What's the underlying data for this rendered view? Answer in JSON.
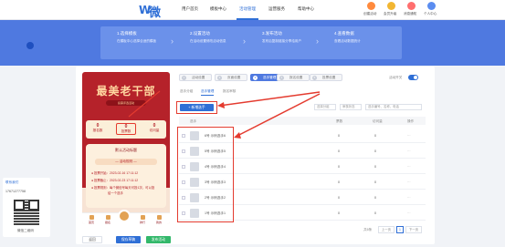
{
  "nav": {
    "logo_text": "微8",
    "menu": [
      {
        "label": "用户首页",
        "active": false
      },
      {
        "label": "模板中心",
        "active": false
      },
      {
        "label": "活动管理",
        "active": true
      },
      {
        "label": "运营服务",
        "active": false
      },
      {
        "label": "帮助中心",
        "active": false
      }
    ],
    "user_items": [
      "创建活动",
      "会员升级",
      "消息通知",
      "个人中心"
    ]
  },
  "steps": [
    {
      "title": "1.选择模板",
      "desc": "在模板中心选择合适的模板"
    },
    {
      "title": "2.设置活动",
      "desc": "在活动设置修改活动信息"
    },
    {
      "title": "3.发布活动",
      "desc": "发布后复制链接分享给用户"
    },
    {
      "title": "4.查看数据",
      "desc": "查看活动数据统计"
    }
  ],
  "phone": {
    "title": "最美老干部",
    "subtitle": "投票评选活动",
    "stats": [
      {
        "num": "0",
        "label": "报名数"
      },
      {
        "num": "0",
        "label": "投票数"
      },
      {
        "num": "0",
        "label": "访问量"
      }
    ],
    "box_title": "默认活动标题",
    "box_subtitle": "— 活动规则 —",
    "rules": [
      "● 投票开始：2023-02-16 17:11:12",
      "● 投票截止：2023-02-23 17:11:12",
      "● 投票规则：每个微信号每天可投1次，可以投",
      "给一个选手"
    ],
    "bottom_nav": [
      "首页",
      "报名",
      "",
      "排行",
      "我的"
    ]
  },
  "editor": {
    "tabs": [
      {
        "n": "1",
        "label": "活动设置",
        "active": false
      },
      {
        "n": "2",
        "label": "页面设置",
        "active": false
      },
      {
        "n": "3",
        "label": "选手管理",
        "active": true
      },
      {
        "n": "4",
        "label": "报名设置",
        "active": false
      },
      {
        "n": "5",
        "label": "投票设置",
        "active": false
      }
    ],
    "toggle_label": "活动开关",
    "subtabs": [
      {
        "label": "选手分组",
        "active": false
      },
      {
        "label": "选手管理",
        "active": true
      },
      {
        "label": "报名审核",
        "active": false
      }
    ],
    "add_button": "+ 新增选手",
    "filter_group": "选择分组",
    "filter_status": "审核状态",
    "search_placeholder": "选手编号、名称、电话",
    "columns": [
      "选手",
      "票数",
      "访问量",
      "操作"
    ],
    "rows": [
      {
        "name": "6号 示例选手6",
        "votes": "0",
        "views": "0"
      },
      {
        "name": "5号 示例选手5",
        "votes": "0",
        "views": "0"
      },
      {
        "name": "4号 示例选手4",
        "votes": "0",
        "views": "0"
      },
      {
        "name": "3号 示例选手3",
        "votes": "0",
        "views": "0"
      },
      {
        "name": "2号 示例选手2",
        "votes": "0",
        "views": "0"
      },
      {
        "name": "1号 示例选手1",
        "votes": "0",
        "views": "0"
      }
    ],
    "op_label": "···",
    "pager_total": "共6条",
    "pager_prev": "上一页",
    "pager_page": "1",
    "pager_next": "下一页",
    "footer_buttons": [
      "返回",
      "保存草稿",
      "发布活动"
    ]
  },
  "sidebar": {
    "contact": "联系我们",
    "phone": "17671277758",
    "qr_caption": "微信二维码"
  },
  "colors": {
    "primary": "#2f6fd6",
    "banner": "#4f79e0",
    "poster": "#b5222a",
    "highlight": "#e43b2f"
  }
}
